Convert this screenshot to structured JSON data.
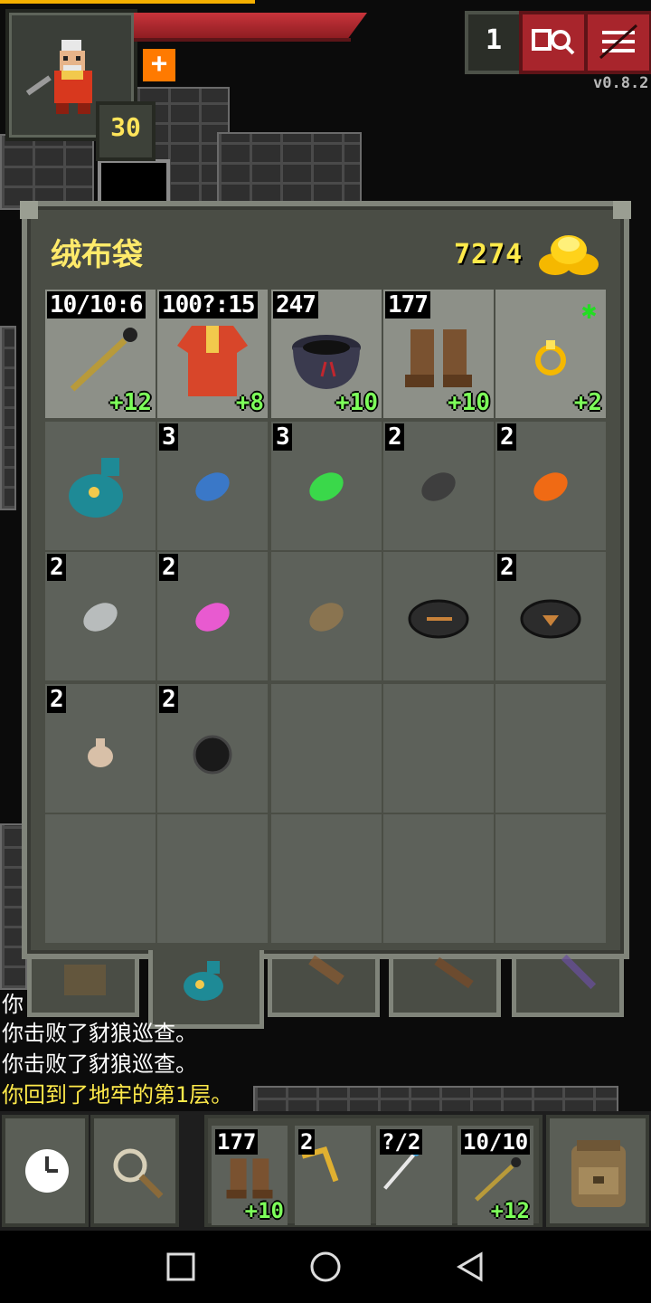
{
  "hud": {
    "hero_level": "30",
    "depth": "1",
    "version": "v0.8.2",
    "buff_glyph": "+"
  },
  "bag": {
    "title": "绒布袋",
    "gold": "7274",
    "slots": [
      {
        "qty": "10/10:6",
        "level": "+12",
        "icon": "staff-icon",
        "equip": true
      },
      {
        "qty": "100?:15",
        "level": "+8",
        "icon": "robe-armor-icon",
        "equip": true
      },
      {
        "qty": "247",
        "level": "+10",
        "icon": "cloak-icon",
        "equip": true
      },
      {
        "qty": "177",
        "level": "+10",
        "icon": "boots-icon",
        "equip": true
      },
      {
        "qty": "",
        "level": "+2",
        "icon": "ring-icon",
        "equip": true,
        "star": "✱"
      },
      {
        "qty": "",
        "level": "",
        "icon": "velvet-pouch-icon"
      },
      {
        "qty": "3",
        "level": "",
        "icon": "blue-seed-icon"
      },
      {
        "qty": "3",
        "level": "",
        "icon": "green-seed-icon"
      },
      {
        "qty": "2",
        "level": "",
        "icon": "dark-seed-icon"
      },
      {
        "qty": "2",
        "level": "",
        "icon": "orange-seed-icon"
      },
      {
        "qty": "2",
        "level": "",
        "icon": "silver-seed-icon"
      },
      {
        "qty": "2",
        "level": "",
        "icon": "pink-seed-icon"
      },
      {
        "qty": "",
        "level": "",
        "icon": "brown-seed-icon"
      },
      {
        "qty": "",
        "level": "",
        "icon": "stone-arrow-icon"
      },
      {
        "qty": "2",
        "level": "",
        "icon": "stone-heart-icon"
      },
      {
        "qty": "2",
        "level": "",
        "icon": "bone-charm-icon"
      },
      {
        "qty": "2",
        "level": "",
        "icon": "black-bomb-icon"
      },
      {
        "qty": "",
        "level": "",
        "icon": ""
      },
      {
        "qty": "",
        "level": "",
        "icon": ""
      },
      {
        "qty": "",
        "level": "",
        "icon": ""
      },
      {
        "qty": "",
        "level": "",
        "icon": ""
      },
      {
        "qty": "",
        "level": "",
        "icon": ""
      },
      {
        "qty": "",
        "level": "",
        "icon": ""
      },
      {
        "qty": "",
        "level": "",
        "icon": ""
      },
      {
        "qty": "",
        "level": "",
        "icon": ""
      }
    ]
  },
  "log": [
    {
      "text": "你",
      "color": "#ffffff"
    },
    {
      "text": "你击败了豺狼巡查。",
      "color": "#ffffff"
    },
    {
      "text": "你击败了豺狼巡查。",
      "color": "#ffffff"
    },
    {
      "text": "你回到了地牢的第1层。",
      "color": "#ffea4a"
    }
  ],
  "quickslots": [
    {
      "qty": "177",
      "level": "+10",
      "icon": "boots-icon"
    },
    {
      "qty": "2",
      "level": "",
      "icon": "boomerang-icon"
    },
    {
      "qty": "?/2",
      "level": "",
      "icon": "wand-icon"
    },
    {
      "qty": "10/10",
      "level": "+12",
      "icon": "staff-icon"
    }
  ],
  "colors": {
    "hp_red": "#c8343b",
    "gold_yellow": "#ffea4a",
    "upgrade_green": "#7dff5a",
    "button_red": "#a8252c"
  }
}
